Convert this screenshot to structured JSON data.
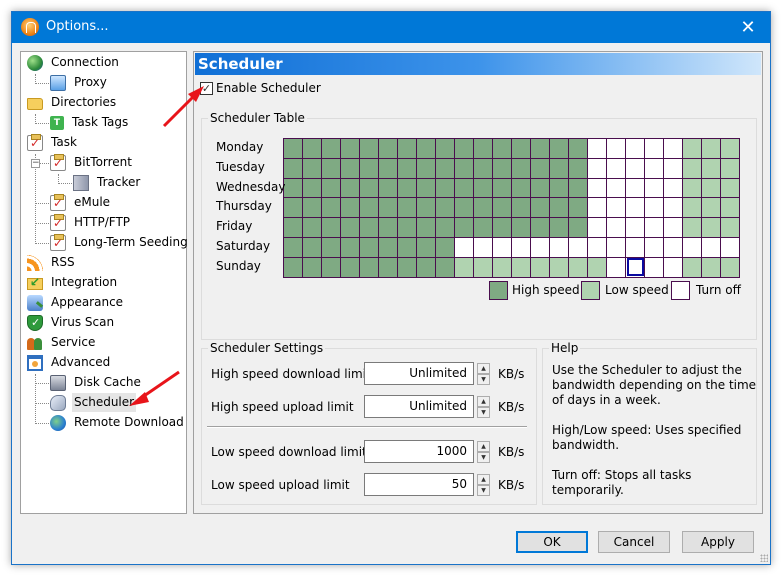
{
  "window": {
    "title": "Options...",
    "close_icon": "close-icon"
  },
  "sidebar": {
    "items": [
      {
        "label": "Connection",
        "icon": "globe-icon",
        "level": 0
      },
      {
        "label": "Proxy",
        "icon": "monitor-icon",
        "level": 1
      },
      {
        "label": "Directories",
        "icon": "folder-icon",
        "level": 0
      },
      {
        "label": "Task Tags",
        "icon": "tag-icon",
        "level": 1
      },
      {
        "label": "Task",
        "icon": "task-icon",
        "level": 0
      },
      {
        "label": "BitTorrent",
        "icon": "task-icon",
        "level": 1,
        "expanded": true
      },
      {
        "label": "Tracker",
        "icon": "server-icon",
        "level": 2
      },
      {
        "label": "eMule",
        "icon": "task-icon",
        "level": 1
      },
      {
        "label": "HTTP/FTP",
        "icon": "task-icon",
        "level": 1
      },
      {
        "label": "Long-Term Seeding",
        "icon": "task-icon",
        "level": 1
      },
      {
        "label": "RSS",
        "icon": "rss-icon",
        "level": 0
      },
      {
        "label": "Integration",
        "icon": "integration-icon",
        "level": 0
      },
      {
        "label": "Appearance",
        "icon": "appearance-icon",
        "level": 0
      },
      {
        "label": "Virus Scan",
        "icon": "shield-icon",
        "level": 0
      },
      {
        "label": "Service",
        "icon": "users-icon",
        "level": 0
      },
      {
        "label": "Advanced",
        "icon": "advanced-icon",
        "level": 0
      },
      {
        "label": "Disk Cache",
        "icon": "disk-icon",
        "level": 1
      },
      {
        "label": "Scheduler",
        "icon": "scheduler-icon",
        "level": 1,
        "selected": true
      },
      {
        "label": "Remote Download",
        "icon": "globe-icon",
        "level": 1
      }
    ],
    "expander_symbol": "−"
  },
  "panel": {
    "header": "Scheduler",
    "enable_label": "Enable Scheduler",
    "enable_checked": true,
    "check_mark": "✓",
    "table_group_title": "Scheduler Table",
    "days": [
      "Monday",
      "Tuesday",
      "Wednesday",
      "Thursday",
      "Friday",
      "Saturday",
      "Sunday"
    ],
    "hours_per_day": 24,
    "schedule": [
      "HHHHHHHHHHHHHHHHOOOOOLLL",
      "HHHHHHHHHHHHHHHHOOOOOLLL",
      "HHHHHHHHHHHHHHHHOOOOOLLL",
      "HHHHHHHHHHHHHHHHOOOOOLLL",
      "HHHHHHHHHHHHHHHHOOOOOLLL",
      "HHHHHHHHHOOOOOOOOOOOOOOO",
      "HHHHHHHHHLLLLLLLLOOOOLLL"
    ],
    "selected_cell": {
      "day": "Sunday",
      "hour": 18
    },
    "legend": [
      {
        "code": "H",
        "label": "High speed",
        "color": "#7faa83"
      },
      {
        "code": "L",
        "label": "Low speed",
        "color": "#b0d3b0"
      },
      {
        "code": "O",
        "label": "Turn off",
        "color": "#ffffff"
      }
    ],
    "grid_line_color": "#4a0e4e",
    "selection_color": "#0a0aa0",
    "settings_group_title": "Scheduler Settings",
    "limits": [
      {
        "label": "High speed download limit",
        "value": "Unlimited",
        "unit": "KB/s"
      },
      {
        "label": "High speed upload limit",
        "value": "Unlimited",
        "unit": "KB/s"
      },
      {
        "label": "Low speed download limit",
        "value": "1000",
        "unit": "KB/s"
      },
      {
        "label": "Low speed upload limit",
        "value": "50",
        "unit": "KB/s"
      }
    ],
    "spin_up": "▲",
    "spin_down": "▼",
    "help_group_title": "Help",
    "help_text": "Use the Scheduler to adjust the bandwidth depending on the time of days in a week.\n\nHigh/Low speed: Uses specified bandwidth.\n\nTurn off: Stops all tasks temporarily."
  },
  "buttons": {
    "ok": "OK",
    "cancel": "Cancel",
    "apply": "Apply"
  },
  "annotations": {
    "arrow_color": "#e8141a"
  }
}
